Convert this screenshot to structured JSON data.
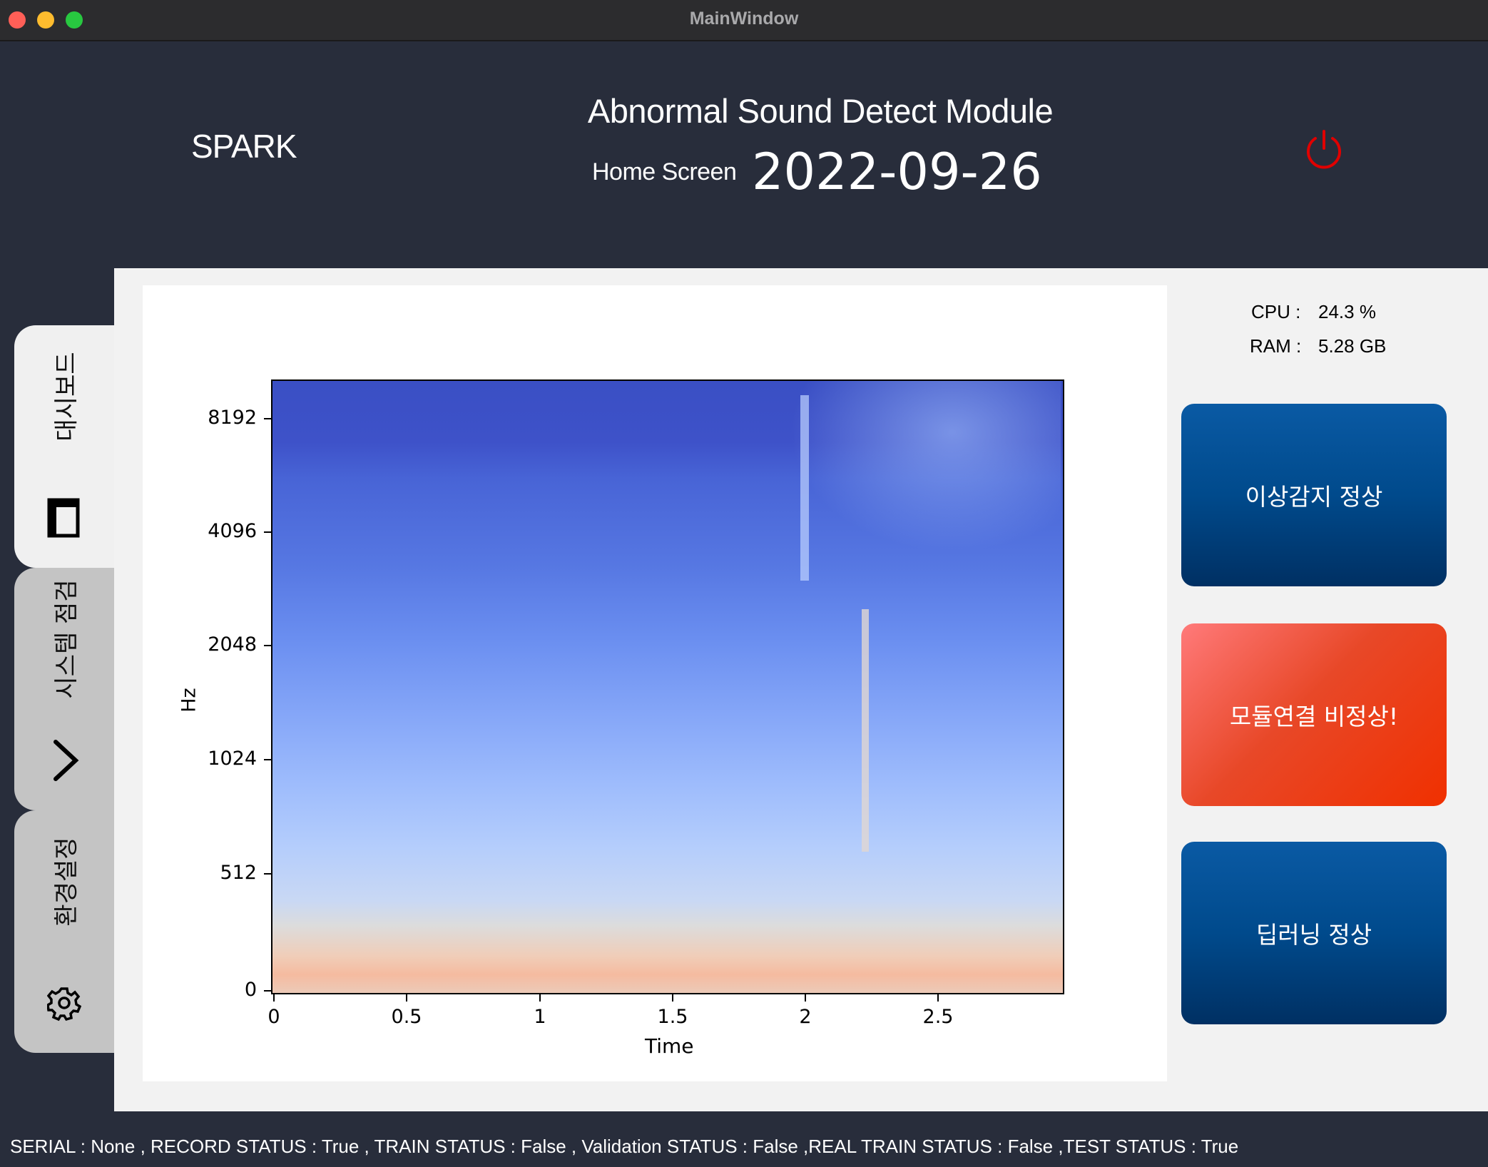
{
  "window": {
    "title": "MainWindow"
  },
  "header": {
    "brand": "SPARK",
    "app_title": "Abnormal Sound Detect Module",
    "screen_name": "Home Screen",
    "date": "2022-09-26"
  },
  "sidebar": {
    "items": [
      {
        "label": "대시보드",
        "icon": "dashboard-window-icon",
        "active": true
      },
      {
        "label": "시스템 점검",
        "icon": "chevron-right-icon",
        "active": false
      },
      {
        "label": "환경설정",
        "icon": "gear-icon",
        "active": false
      }
    ]
  },
  "chart_data": {
    "type": "heatmap",
    "xlabel": "Time",
    "ylabel": "Hz",
    "x_ticks": [
      "0",
      "0.5",
      "1",
      "1.5",
      "2",
      "2.5"
    ],
    "y_ticks": [
      "8192",
      "4096",
      "2048",
      "1024",
      "512",
      "0"
    ],
    "xlim": [
      0,
      2.97
    ],
    "colormap": "coolwarm",
    "y_scale": "log-like (mel)"
  },
  "stats": {
    "cpu_label": "CPU :",
    "cpu_value": "24.3 %",
    "ram_label": "RAM :",
    "ram_value": "5.28 GB"
  },
  "status_buttons": [
    {
      "label": "이상감지 정상",
      "state": "normal",
      "color": "#004a8c"
    },
    {
      "label": "모듈연결 비정상!",
      "state": "abnormal",
      "color": "#e84828"
    },
    {
      "label": "딥러닝 정상",
      "state": "normal",
      "color": "#004a8c"
    }
  ],
  "statusbar": {
    "text": "SERIAL : None , RECORD STATUS : True , TRAIN STATUS : False , Validation STATUS : False ,REAL TRAIN STATUS : False ,TEST STATUS : True"
  },
  "colors": {
    "background": "#282d3b",
    "power_icon": "#e00000"
  }
}
